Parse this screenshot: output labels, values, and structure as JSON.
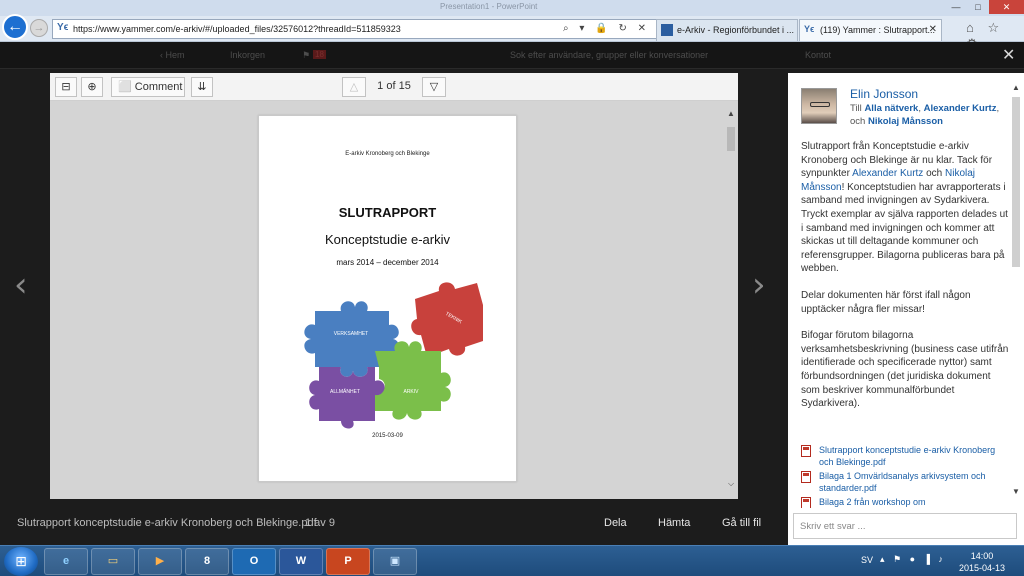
{
  "browser": {
    "window_title": "Presentation1 - PowerPoint",
    "url_favicon": "Yϵ",
    "url": "https://www.yammer.com/e-arkiv/#/uploaded_files/32576012?threadId=511859323",
    "address_tools": "⌕ ▾ 🔒 ↻ ✕",
    "tabs": [
      {
        "label": "e-Arkiv - Regionförbundet i ...",
        "active": false
      },
      {
        "label": "(119) Yammer : Slutrapport...",
        "active": true
      }
    ],
    "back_glyph": "←",
    "forward_glyph": "→",
    "tab_close_glyph": "✕",
    "icons": "⌂ ☆ ⚙",
    "window_controls": {
      "minimize": "—",
      "maximize": "□",
      "close": "✕"
    }
  },
  "yammer_header": {
    "items": [
      "‹ Hem",
      "Inkorgen",
      "18",
      "⚑",
      "Sok efter användare, grupper eller konversationer",
      "Kontot"
    ],
    "overlay_close_glyph": "✕"
  },
  "viewer": {
    "toolbar": {
      "zoom_out_glyph": "⊟",
      "zoom_in_glyph": "⊕",
      "comment_label": "Comment",
      "comment_glyph": "⬜",
      "download_glyph": "⇊",
      "prev_page_glyph": "△",
      "next_page_glyph": "▽",
      "page_indicator": "1 of 15"
    },
    "page": {
      "header": "E-arkiv Kronoberg och Blekinge",
      "title": "SLUTRAPPORT",
      "subtitle": "Konceptstudie e-arkiv",
      "dates": "mars 2014 – december 2014",
      "puzzle_labels": [
        "VERKSAMHET",
        "TEKNIK",
        "ALLMÄNHET",
        "ARKIV"
      ],
      "footer_date": "2015-03-09"
    },
    "scroll_up_glyph": "▲",
    "scroll_down_glyph": "⌵",
    "prev_arrow": "‹",
    "next_arrow": "›"
  },
  "filebar": {
    "filename": "Slutrapport konceptstudie e-arkiv Kronoberg och Blekinge.pdf",
    "count": "1 av 9",
    "actions": [
      "Dela",
      "Hämta",
      "Gå till fil"
    ]
  },
  "thread": {
    "author": "Elin Jonsson",
    "recipients_prefix": "Till",
    "recipients": [
      "Alla nätverk",
      "Alexander Kurtz",
      "Nikolaj Månsson"
    ],
    "sep_comma": ",",
    "sep_och": ", och",
    "message_p1_a": "Slutrapport från Konceptstudie e-arkiv Kronoberg och Blekinge är nu klar. Tack för synpunkter ",
    "message_p1_link1": "Alexander Kurtz",
    "message_p1_b": " och ",
    "message_p1_link2": "Nikolaj Månsson",
    "message_p1_c": "! Konceptstudien har avrapporterats i samband med invigningen av Sydarkivera. Tryckt exemplar av själva rapporten delades ut i samband med invigningen och kommer att skickas ut till deltagande kommuner och referensgrupper. Bilagorna publiceras bara på webben.",
    "message_p2": "Delar dokumenten här först ifall någon upptäcker några fler missar!",
    "message_p3": "Bifogar förutom bilagorna verksamhetsbeskrivning (business case utifrån identifierade och specificerade nyttor) samt förbundsordningen (det juridiska dokument som beskriver kommunalförbundet Sydarkivera).",
    "attachments": [
      "Slutrapport konceptstudie e-arkiv Kronoberg och Blekinge.pdf",
      "Bilaga 1 Omvärldsanalys arkivsystem och standarder.pdf",
      "Bilaga 2 från workshop om"
    ],
    "reply_placeholder": "Skriv ett svar ...",
    "scroll_up_glyph": "▲",
    "scroll_down_glyph": "▼"
  },
  "taskbar": {
    "start_glyph": "⊞",
    "apps": [
      {
        "name": "Internet Explorer",
        "glyph": "e"
      },
      {
        "name": "File Explorer",
        "glyph": "▭"
      },
      {
        "name": "Media Player",
        "glyph": "▶"
      },
      {
        "name": "KeePass",
        "glyph": "8"
      },
      {
        "name": "Outlook",
        "glyph": "O"
      },
      {
        "name": "Word",
        "glyph": "W"
      },
      {
        "name": "PowerPoint",
        "glyph": "P"
      },
      {
        "name": "Photo Viewer",
        "glyph": "▣"
      }
    ],
    "language": "SV",
    "tray_icons": "▴ ⚑ ● ▐ ♪",
    "time": "14:00",
    "date": "2015-04-13"
  }
}
